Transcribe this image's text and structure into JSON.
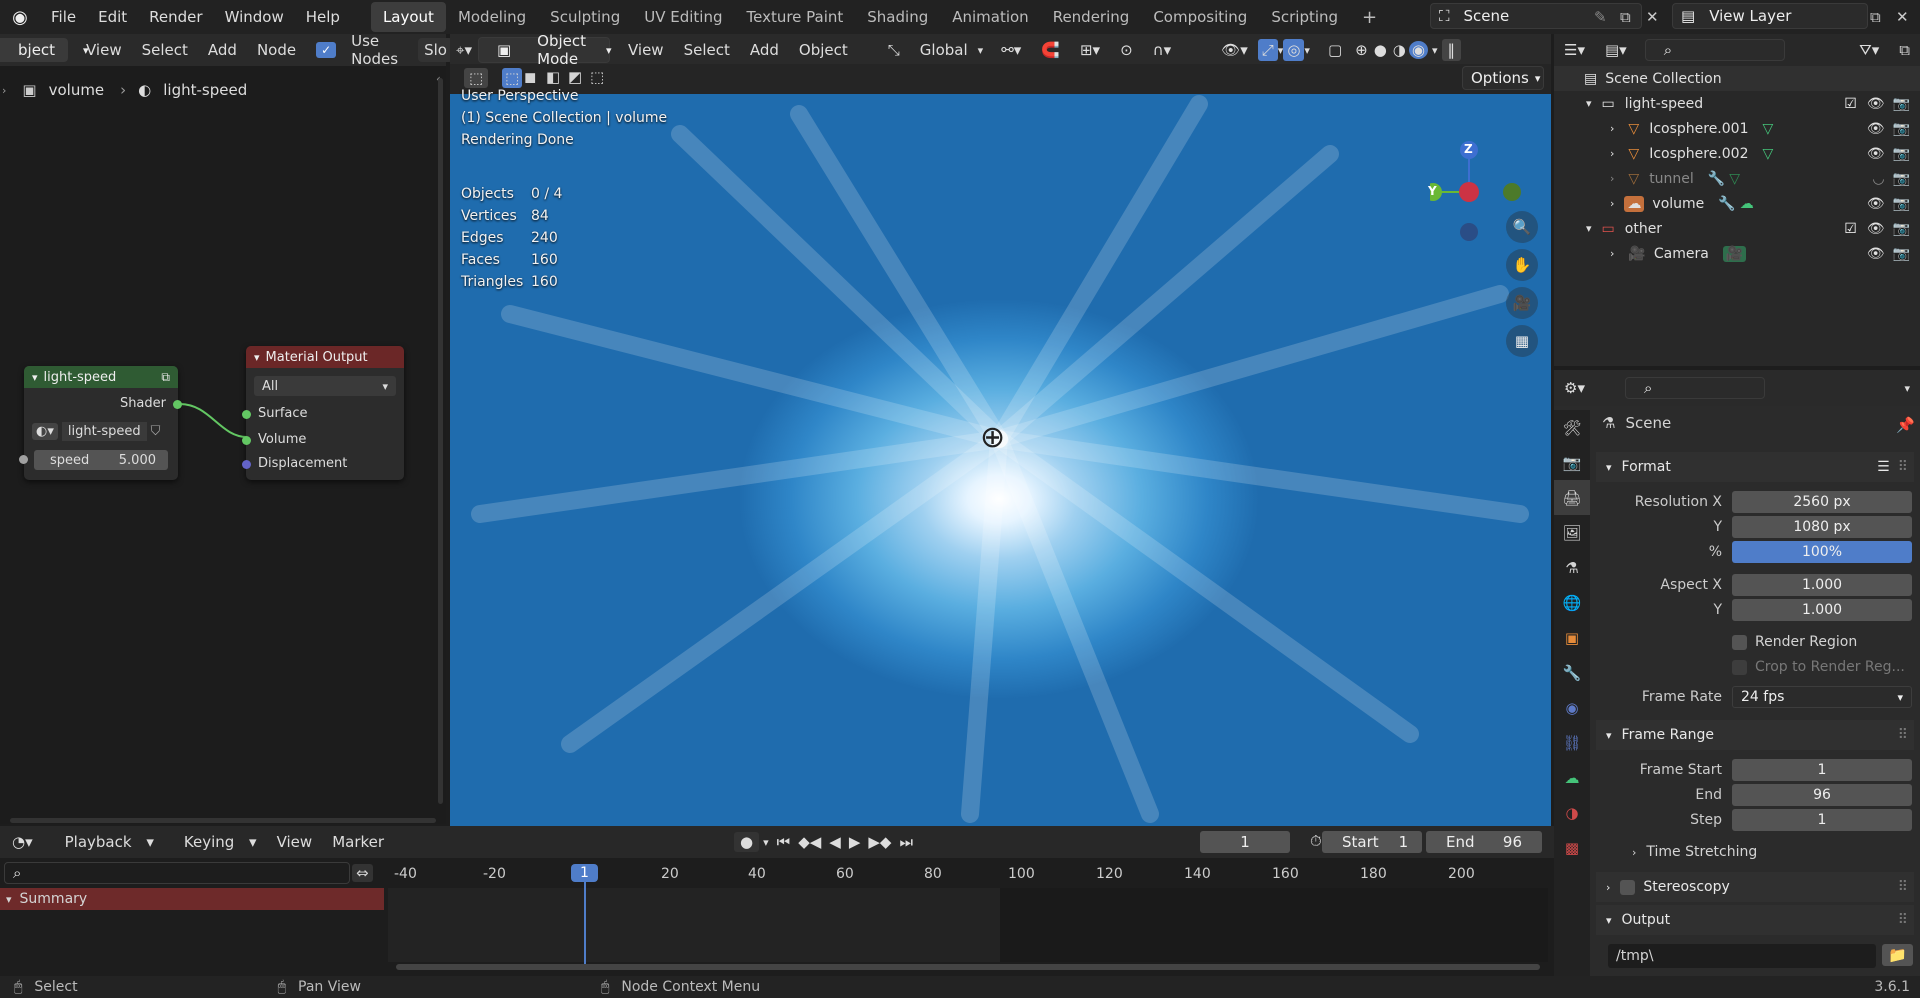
{
  "menubar": {
    "items": [
      "File",
      "Edit",
      "Render",
      "Window",
      "Help"
    ],
    "workspaces": [
      "Layout",
      "Modeling",
      "Sculpting",
      "UV Editing",
      "Texture Paint",
      "Shading",
      "Animation",
      "Rendering",
      "Compositing",
      "Scripting"
    ],
    "active_workspace": "Layout",
    "add_tab": "+",
    "scene": "Scene",
    "view_layer": "View Layer"
  },
  "node_editor": {
    "mode": "bject",
    "menus": [
      "View",
      "Select",
      "Add",
      "Node"
    ],
    "use_nodes_label": "Use Nodes",
    "cut_label": "Slo",
    "breadcrumb_object": "volume",
    "breadcrumb_material": "light-speed",
    "group_node": {
      "title": "light-speed",
      "output": "Shader",
      "material": "light-speed",
      "param_label": "speed",
      "param_value": "5.000"
    },
    "output_node": {
      "title": "Material Output",
      "target": "All",
      "inputs": [
        "Surface",
        "Volume",
        "Displacement"
      ]
    }
  },
  "viewport": {
    "mode": "Object Mode",
    "menus": [
      "View",
      "Select",
      "Add",
      "Object"
    ],
    "transform": "Global",
    "options_label": "Options",
    "overlay_lines": [
      "User Perspective",
      "(1) Scene Collection | volume",
      "Rendering Done"
    ],
    "stats": [
      {
        "label": "Objects",
        "value": "0 / 4"
      },
      {
        "label": "Vertices",
        "value": "84"
      },
      {
        "label": "Edges",
        "value": "240"
      },
      {
        "label": "Faces",
        "value": "160"
      },
      {
        "label": "Triangles",
        "value": "160"
      }
    ],
    "gizmo": {
      "z": "Z",
      "y": "Y"
    }
  },
  "outliner": {
    "root": "Scene Collection",
    "items": [
      {
        "name": "light-speed"
      },
      {
        "name": "Icosphere.001"
      },
      {
        "name": "Icosphere.002"
      },
      {
        "name": "tunnel"
      },
      {
        "name": "volume"
      },
      {
        "name": "other"
      },
      {
        "name": "Camera"
      }
    ]
  },
  "properties": {
    "context": "Scene",
    "format_label": "Format",
    "resolution_x_label": "Resolution X",
    "resolution_x": "2560 px",
    "y_label": "Y",
    "resolution_y": "1080 px",
    "percent_label": "%",
    "percent": "100%",
    "aspect_x_label": "Aspect X",
    "aspect_x": "1.000",
    "aspect_y": "1.000",
    "render_region": "Render Region",
    "crop_region": "Crop to Render Reg...",
    "frame_rate_label": "Frame Rate",
    "frame_rate": "24 fps",
    "frame_range_label": "Frame Range",
    "frame_start_label": "Frame Start",
    "frame_start": "1",
    "end_label": "End",
    "frame_end": "96",
    "step_label": "Step",
    "step": "1",
    "time_stretching": "Time Stretching",
    "stereoscopy": "Stereoscopy",
    "output_label": "Output",
    "output_path": "/tmp\\"
  },
  "timeline": {
    "menus": [
      "Playback",
      "Keying",
      "View",
      "Marker"
    ],
    "current_frame": "1",
    "start_label": "Start",
    "start": "1",
    "end_label": "End",
    "end": "96",
    "summary": "Summary",
    "ticks": [
      "-40",
      "-20",
      "1",
      "20",
      "40",
      "60",
      "80",
      "100",
      "120",
      "140",
      "160",
      "180",
      "200"
    ]
  },
  "statusbar": {
    "select": "Select",
    "pan": "Pan View",
    "context": "Node Context Menu",
    "version": "3.6.1"
  }
}
